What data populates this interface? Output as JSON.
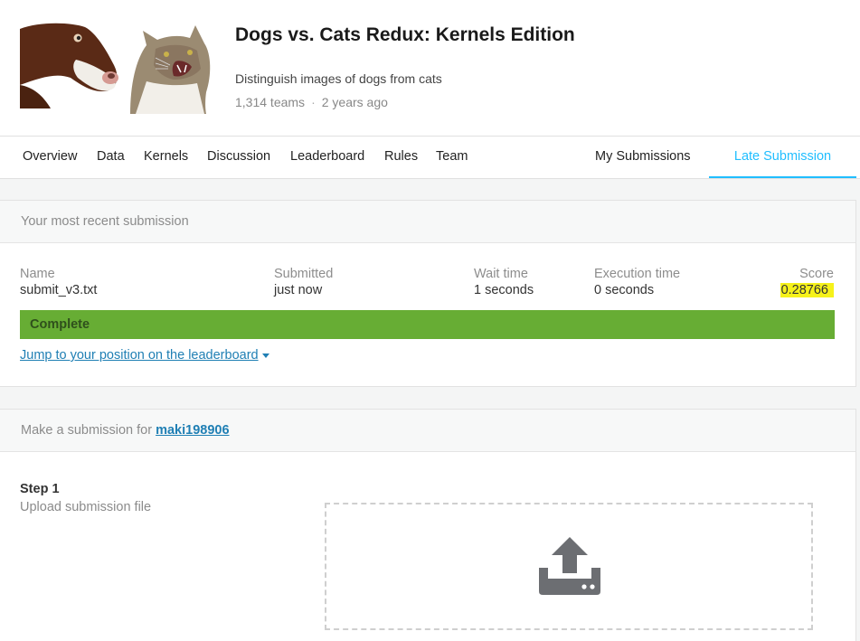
{
  "competition": {
    "title": "Dogs vs. Cats Redux: Kernels Edition",
    "subtitle": "Distinguish images of dogs from cats",
    "teams": "1,314 teams",
    "separator": "·",
    "age": "2 years ago"
  },
  "nav": {
    "tabs": [
      {
        "label": "Overview"
      },
      {
        "label": "Data"
      },
      {
        "label": "Kernels"
      },
      {
        "label": "Discussion"
      },
      {
        "label": "Leaderboard"
      },
      {
        "label": "Rules"
      },
      {
        "label": "Team"
      }
    ],
    "my_submissions": "My Submissions",
    "late_submission": "Late Submission",
    "active_color": "#20beff"
  },
  "recent": {
    "header": "Your most recent submission",
    "columns": {
      "name": {
        "header": "Name",
        "value": "submit_v3.txt"
      },
      "submitted": {
        "header": "Submitted",
        "value": "just now"
      },
      "wait": {
        "header": "Wait time",
        "value": "1 seconds"
      },
      "execution": {
        "header": "Execution time",
        "value": "0 seconds"
      },
      "score": {
        "header": "Score",
        "value": "0.28766"
      }
    },
    "status": "Complete",
    "status_color": "#67ad34",
    "jump_link": "Jump to your position on the leaderboard"
  },
  "submit": {
    "header_prefix": "Make a submission for ",
    "username": "maki198906",
    "step_title": "Step 1",
    "step_subtitle": "Upload submission file",
    "upload_icon": "upload-icon"
  }
}
